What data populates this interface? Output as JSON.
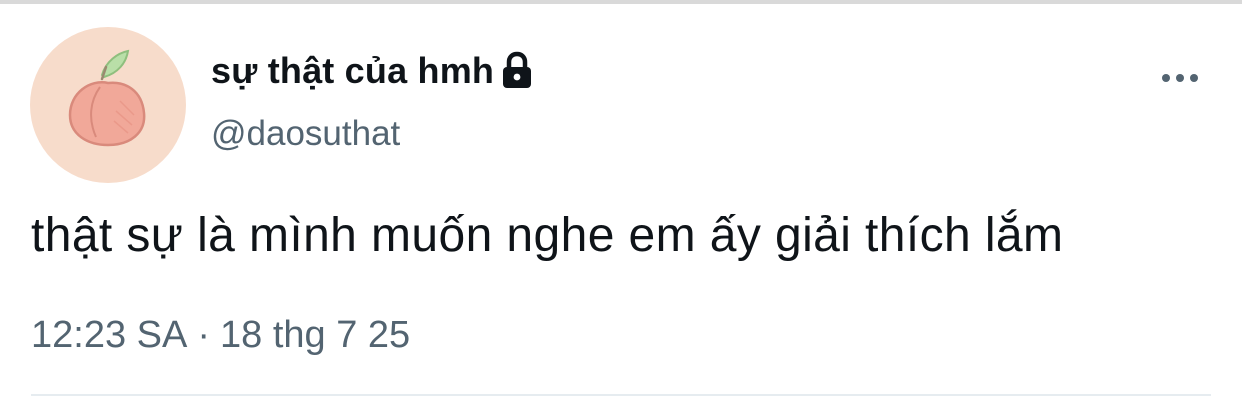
{
  "tweet": {
    "author": {
      "display_name": "sự thật của hmh",
      "handle": "@daosuthat",
      "protected_icon": "lock-icon",
      "avatar_icon": "peach-icon"
    },
    "text": "thật sự là mình muốn nghe em ấy giải thích lắm",
    "time": "12:23 SA",
    "separator": "·",
    "date": "18 thg 7 25",
    "more_icon": "more-horizontal-icon"
  },
  "colors": {
    "text_primary": "#0f1419",
    "text_secondary": "#536471",
    "avatar_background": "#f7dccb",
    "peach": "#f0a89a",
    "leaf": "#a8d49a"
  }
}
